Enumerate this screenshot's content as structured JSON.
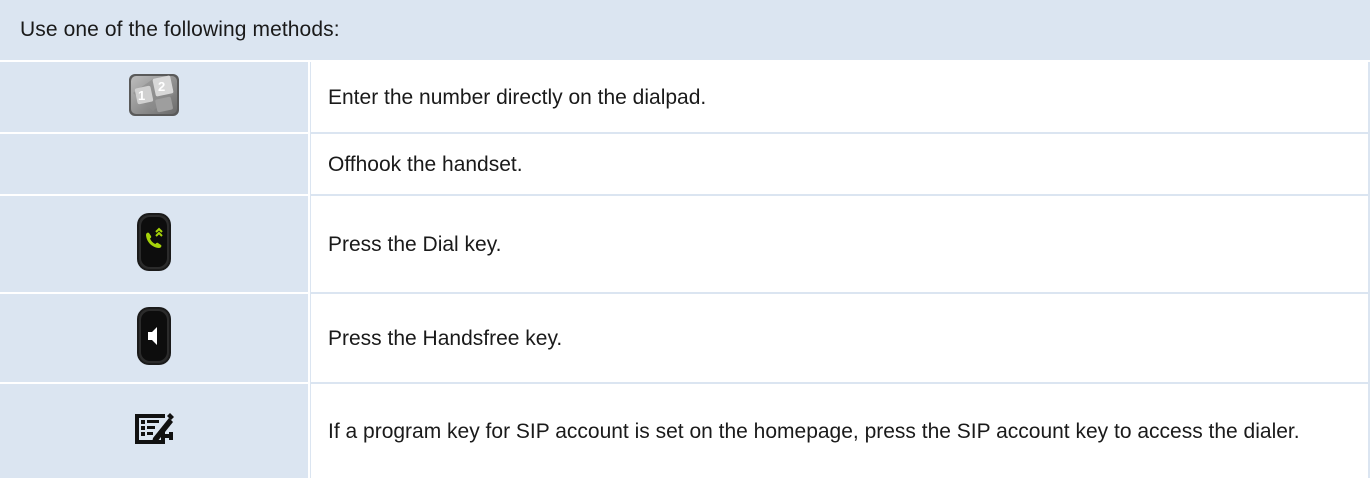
{
  "header": {
    "title": "Use one of the following methods:"
  },
  "rows": [
    {
      "icon": "dialpad-icon",
      "text": "Enter the number directly on the dialpad."
    },
    {
      "icon": "",
      "text": "Offhook the handset."
    },
    {
      "icon": "dial-key-icon",
      "text": "Press the Dial key."
    },
    {
      "icon": "handsfree-key-icon",
      "text": "Press the Handsfree key."
    },
    {
      "icon": "sip-account-icon",
      "text": "If a program key for SIP account is set on the homepage, press the SIP account key to access the dialer."
    }
  ],
  "colors": {
    "header_bg": "#dbe5f1",
    "icon_cell_bg": "#dbe5f1",
    "text_bg": "#ffffff",
    "dial_key_green": "#a6d30a",
    "key_black": "#111111"
  }
}
